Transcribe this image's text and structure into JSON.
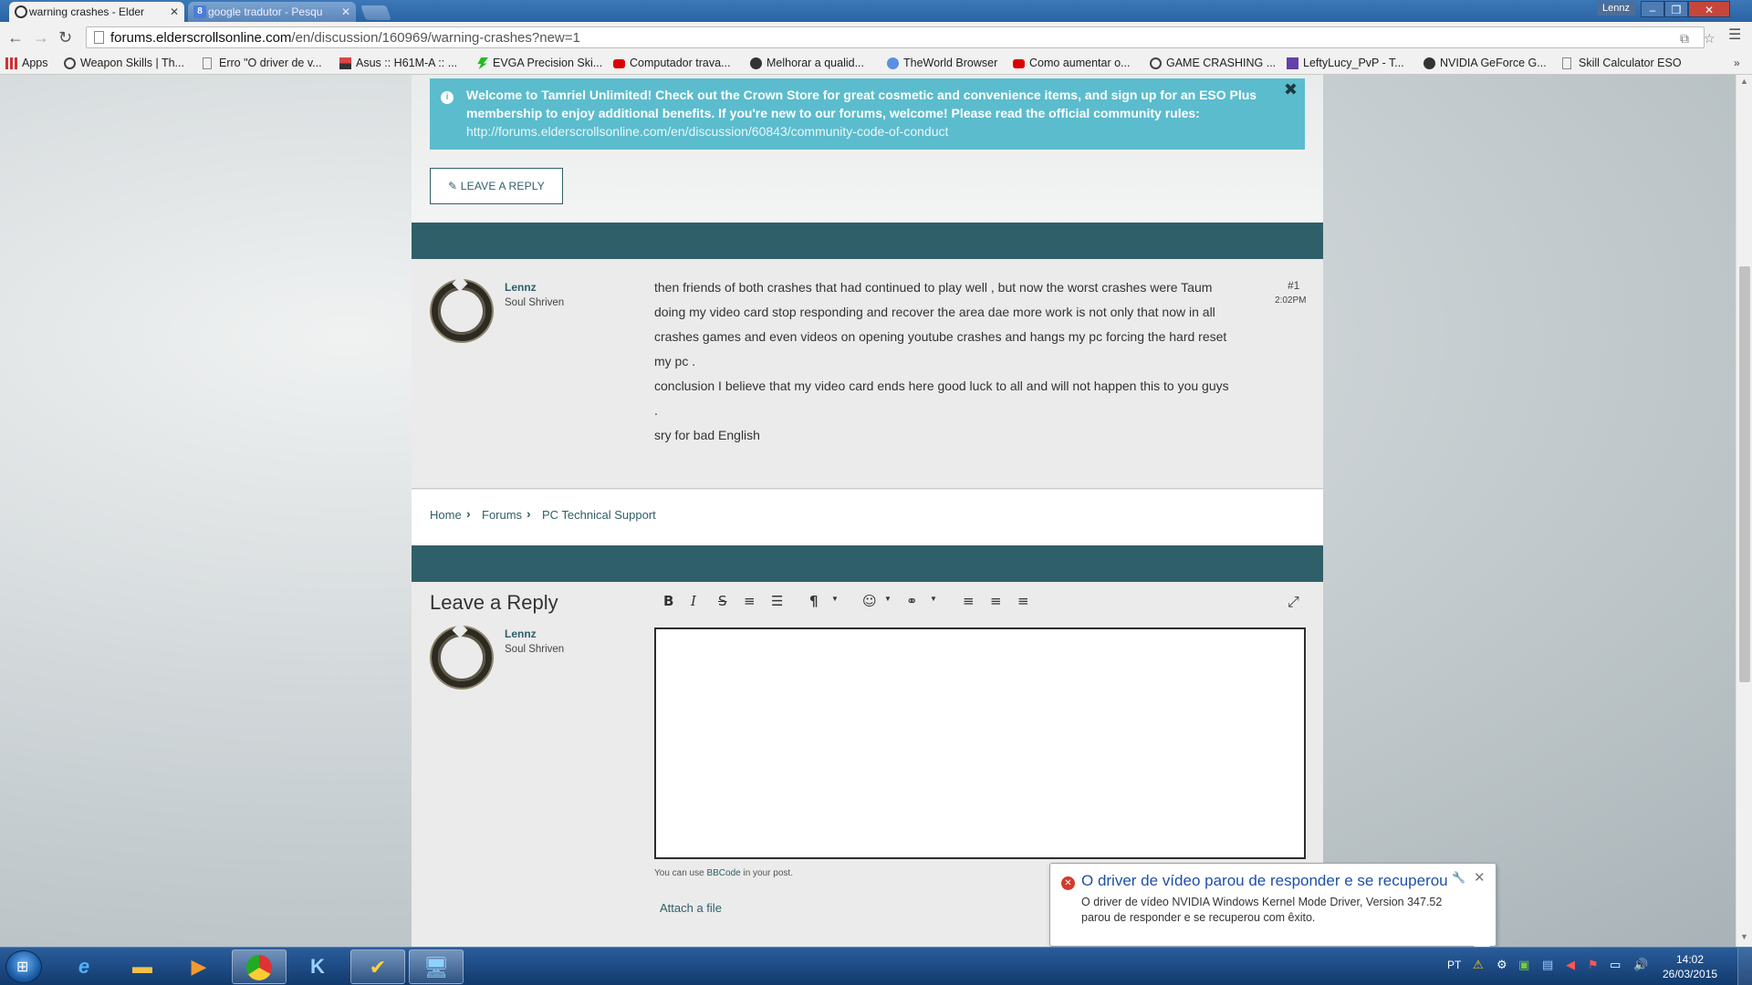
{
  "browser": {
    "tabs": [
      {
        "title": "warning crashes - Elder",
        "active": true
      },
      {
        "title": "google tradutor - Pesqu",
        "active": false
      }
    ],
    "profile": "Lennz",
    "url_host": "forums.elderscrollsonline.com",
    "url_path": "/en/discussion/160969/warning-crashes?new=1",
    "bookmarks": [
      "Apps",
      "Weapon Skills | Th...",
      "Erro \"O driver de v...",
      "Asus :: H61M-A :: ...",
      "EVGA Precision Ski...",
      "Computador trava...",
      "Melhorar a qualid...",
      "TheWorld Browser",
      "Como aumentar o...",
      "GAME CRASHING ...",
      "LeftyLucy_PvP - T...",
      "NVIDIA GeForce G...",
      "Skill Calculator ESO"
    ],
    "bookmarks_more": "»"
  },
  "notice": {
    "text": "Welcome to Tamriel Unlimited! Check out the Crown Store for great cosmetic and convenience items, and sign up for an ESO Plus membership to enjoy additional benefits. If you're new to our forums, welcome! Please read the official community rules:",
    "link": "http://forums.elderscrollsonline.com/en/discussion/60843/community-code-of-conduct",
    "close": "✖"
  },
  "leave_reply_button": "LEAVE A REPLY",
  "post": {
    "author": "Lennz",
    "rank": "Soul Shriven",
    "number": "#1",
    "time": "2:02PM",
    "lines": [
      "then friends of both crashes that had continued to play well , but now the worst crashes were Taum doing my video card stop responding and recover the area dae more work is not only that now in all crashes games and even videos on opening youtube crashes and hangs my pc forcing the hard reset my pc .",
      "conclusion I believe that my video card ends here good luck to all and will not happen this to you guys .",
      "sry for bad English"
    ]
  },
  "breadcrumb": [
    "Home",
    "Forums",
    "PC Technical Support"
  ],
  "reply": {
    "title": "Leave a Reply",
    "author": "Lennz",
    "rank": "Soul Shriven",
    "bbcode_prefix": "You can use ",
    "bbcode_link": "BBCode",
    "bbcode_suffix": " in your post.",
    "attach": "Attach a file",
    "toolbar": {
      "bold": "B",
      "italic": "I",
      "strike": "S",
      "ordered_list": "≡",
      "unordered_list": "☰",
      "paragraph": "¶",
      "emoji": "☺",
      "link": "⚭",
      "align_left": "≡",
      "align_center": "≡",
      "align_right": "≡",
      "fullscreen": "⤢",
      "caret": "▼"
    }
  },
  "balloon": {
    "title": "O driver de vídeo parou de responder e se recuperou",
    "text": "O driver de vídeo NVIDIA Windows Kernel Mode Driver, Version 347.52 parou de responder e se recuperou com êxito."
  },
  "taskbar": {
    "language": "PT",
    "time": "14:02",
    "date": "26/03/2015"
  },
  "colors": {
    "teal": "#2f5f68",
    "notice_bg": "#5bbccd",
    "taskbar": "#1d4a86"
  }
}
